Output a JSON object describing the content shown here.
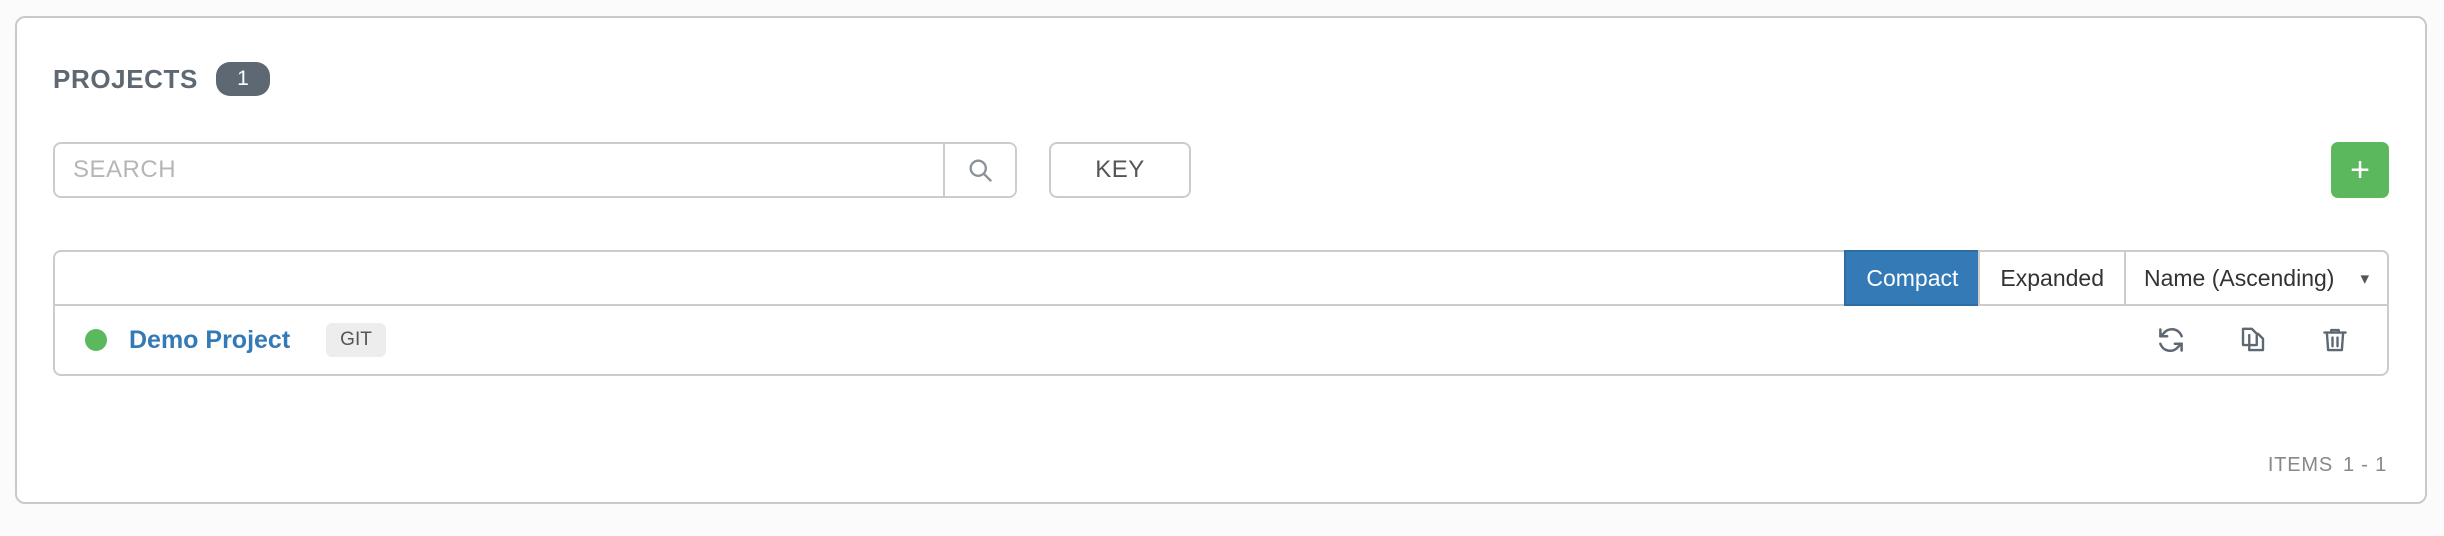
{
  "panel": {
    "title": "PROJECTS",
    "count": "1"
  },
  "search": {
    "placeholder": "SEARCH",
    "value": "",
    "search_icon": "search-icon",
    "key_label": "KEY"
  },
  "add_button": {
    "label": "+",
    "color": "#5cb85c"
  },
  "toolbar": {
    "view_modes": [
      {
        "label": "Compact",
        "active": true
      },
      {
        "label": "Expanded",
        "active": false
      }
    ],
    "sort": {
      "selected": "Name (Ascending)",
      "chevron": "chevron-down-icon"
    },
    "active_color": "#337ab7"
  },
  "projects": [
    {
      "status": "green",
      "status_color": "#5cb85c",
      "name": "Demo Project",
      "scm_type": "GIT",
      "actions": [
        {
          "name": "sync-project-icon"
        },
        {
          "name": "copy-project-icon"
        },
        {
          "name": "delete-project-icon"
        }
      ]
    }
  ],
  "footer": {
    "items_label": "ITEMS",
    "items_range": "1 - 1"
  }
}
